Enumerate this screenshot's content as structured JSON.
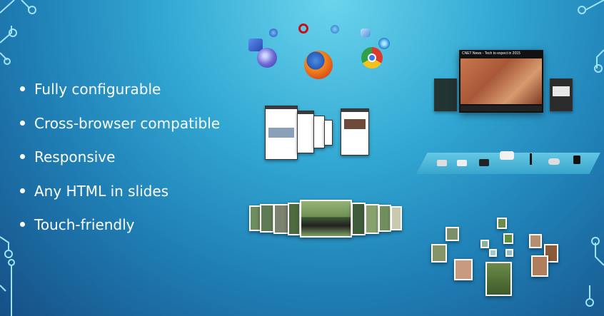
{
  "bullets": [
    "Fully configurable",
    "Cross-browser compatible",
    "Responsive",
    "Any HTML in slides",
    "Touch-friendly"
  ],
  "video": {
    "title": "CNET News - Tech to expect in 2015"
  },
  "icons": {
    "browsers": [
      "safari-icon",
      "opera-icon",
      "chrome-icon",
      "firefox-icon",
      "ie-icon",
      "browser-small-icons"
    ],
    "products": [
      "camera-icon",
      "camera-icon",
      "camera-icon",
      "projector-icon",
      "pen-icon",
      "lens-icon",
      "lens-icon"
    ]
  },
  "colors": {
    "accent": "#2fa3d0",
    "text": "#ffffff"
  }
}
